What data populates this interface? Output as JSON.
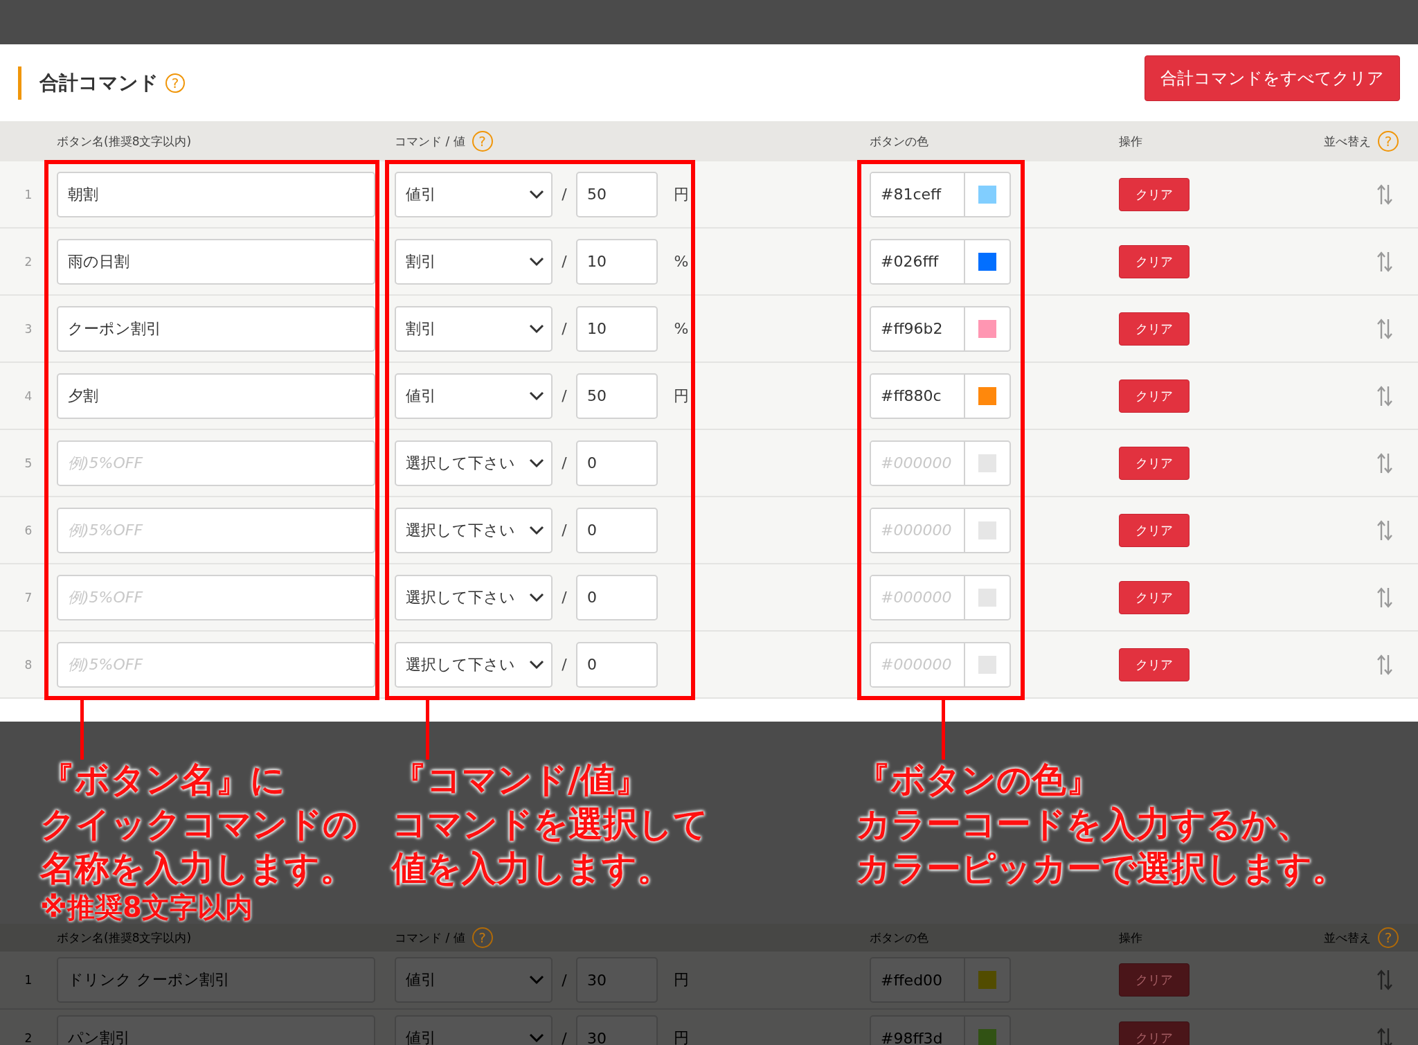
{
  "section": {
    "title": "合計コマンド",
    "title_help": "?",
    "clear_all_button": "合計コマンドをすべてクリア",
    "columns": [
      {
        "label": "ボタン名(推奨8文字以内)"
      },
      {
        "label": "コマンド / 値",
        "help": "?"
      },
      {
        "label": "ボタンの色"
      },
      {
        "label": "操作"
      },
      {
        "label": "並べ替え",
        "help": "?"
      }
    ],
    "rows": [
      {
        "number": "1",
        "name": "朝割",
        "command": "値引",
        "separator": "/",
        "value": "50",
        "unit": "円",
        "color": "#81ceff",
        "clear": "クリア"
      },
      {
        "number": "2",
        "name": "雨の日割",
        "command": "割引",
        "separator": "/",
        "value": "10",
        "unit": "%",
        "color": "#026fff",
        "clear": "クリア"
      },
      {
        "number": "3",
        "name": "クーポン割引",
        "command": "割引",
        "separator": "/",
        "value": "10",
        "unit": "%",
        "color": "#ff96b2",
        "clear": "クリア"
      },
      {
        "number": "4",
        "name": "夕割",
        "command": "値引",
        "separator": "/",
        "value": "50",
        "unit": "円",
        "color": "#ff880c",
        "clear": "クリア"
      },
      {
        "number": "5",
        "name_placeholder": "例)5%OFF",
        "command": "選択して下さい",
        "separator": "/",
        "value": "0",
        "color_placeholder": "#000000",
        "clear": "クリア"
      },
      {
        "number": "6",
        "name_placeholder": "例)5%OFF",
        "command": "選択して下さい",
        "separator": "/",
        "value": "0",
        "color_placeholder": "#000000",
        "clear": "クリア"
      },
      {
        "number": "7",
        "name_placeholder": "例)5%OFF",
        "command": "選択して下さい",
        "separator": "/",
        "value": "0",
        "color_placeholder": "#000000",
        "clear": "クリア"
      },
      {
        "number": "8",
        "name_placeholder": "例)5%OFF",
        "command": "選択して下さい",
        "separator": "/",
        "value": "0",
        "color_placeholder": "#000000",
        "clear": "クリア"
      }
    ]
  },
  "callouts": [
    {
      "lines": [
        "『ボタン名』に",
        "クイックコマンドの",
        "名称を入力します。"
      ],
      "note": "※推奨8文字以内"
    },
    {
      "lines": [
        "『コマンド/値』",
        "コマンドを選択して",
        "値を入力します。"
      ]
    },
    {
      "lines": [
        "『ボタンの色』",
        "カラーコードを入力するか、",
        "カラーピッカーで選択します。"
      ]
    }
  ],
  "lower_section": {
    "columns": [
      {
        "label": "ボタン名(推奨8文字以内)"
      },
      {
        "label": "コマンド / 値",
        "help": "?"
      },
      {
        "label": "ボタンの色"
      },
      {
        "label": "操作"
      },
      {
        "label": "並べ替え",
        "help": "?"
      }
    ],
    "rows": [
      {
        "number": "1",
        "name": "ドリンク クーポン割引",
        "command": "値引",
        "separator": "/",
        "value": "30",
        "unit": "円",
        "color_code": "#ffed00",
        "color": "#524c00",
        "clear": "クリア"
      },
      {
        "number": "2",
        "name": "パン割引",
        "command": "値引",
        "separator": "/",
        "value": "30",
        "unit": "円",
        "color_code": "#98ff3d",
        "color": "#315214",
        "clear": "クリア"
      }
    ]
  }
}
